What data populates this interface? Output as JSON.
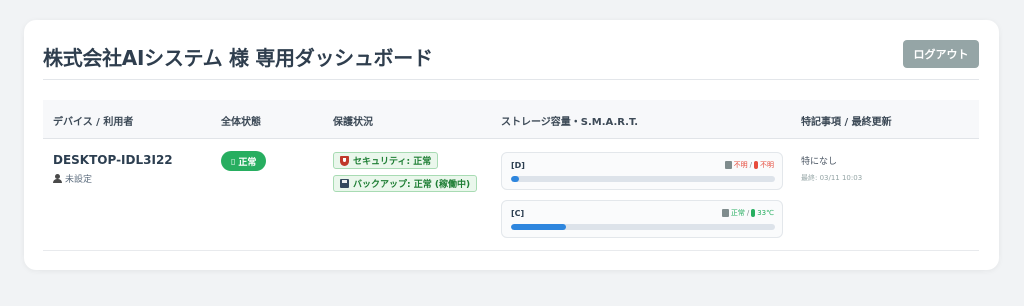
{
  "header": {
    "title": "株式会社AIシステム 様 専用ダッシュボード",
    "logout_label": "ログアウト"
  },
  "table": {
    "columns": [
      "デバイス / 利用者",
      "全体状態",
      "保護状況",
      "ストレージ容量・S.M.A.R.T.",
      "特記事項 / 最終更新"
    ],
    "rows": [
      {
        "device": "DESKTOP-IDL3I22",
        "user": "未設定",
        "status": "正常",
        "status_icon": "▯",
        "protection": [
          {
            "icon": "shield-icon",
            "label": "セキュリティ: 正常"
          },
          {
            "icon": "disk-icon",
            "label": "バックアップ: 正常 (稼働中)"
          }
        ],
        "drives": [
          {
            "label": "[D]",
            "health": "不明",
            "temp": "不明",
            "usage_percent": 3,
            "health_color": "#e74c3c",
            "temp_color": "#e74c3c"
          },
          {
            "label": "[C]",
            "health": "正常",
            "temp": "33℃",
            "usage_percent": 21,
            "health_color": "#27ae60",
            "temp_color": "#27ae60"
          }
        ],
        "note": "特になし",
        "updated": "最終: 03/11 10:03"
      }
    ]
  },
  "colors": {
    "ok_green": "#27ae60",
    "bar_blue": "#2e86de",
    "logout_gray": "#95a5a6"
  }
}
